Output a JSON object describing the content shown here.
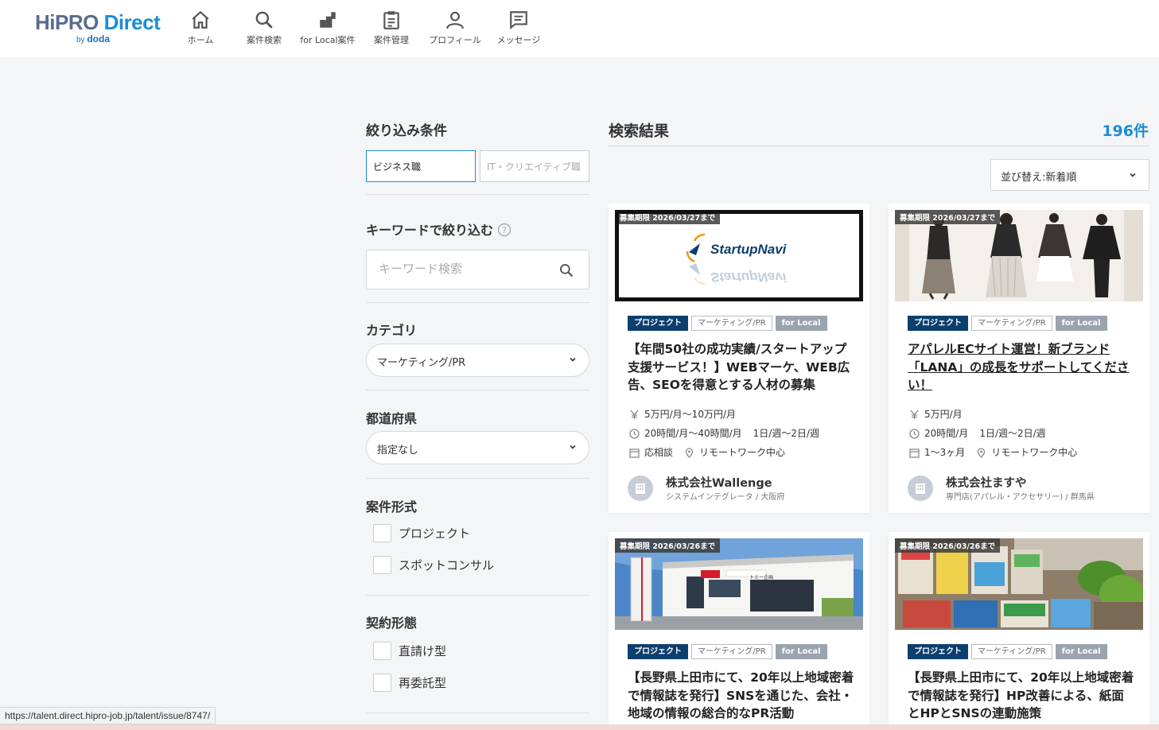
{
  "header": {
    "logo": {
      "part1": "HiPRO",
      "part2": " Direct",
      "by": "by",
      "brand": "doda"
    },
    "nav": [
      {
        "label": "ホーム",
        "icon": "home-icon"
      },
      {
        "label": "案件検索",
        "icon": "search-icon"
      },
      {
        "label": "for Local案件",
        "icon": "local-icon"
      },
      {
        "label": "案件管理",
        "icon": "clipboard-icon"
      },
      {
        "label": "プロフィール",
        "icon": "profile-icon"
      },
      {
        "label": "メッセージ",
        "icon": "message-icon"
      }
    ]
  },
  "filter": {
    "title": "絞り込み条件",
    "tabs": [
      {
        "label": "ビジネス職",
        "active": true
      },
      {
        "label": "IT・クリエイティブ職",
        "active": false
      }
    ],
    "keyword": {
      "title": "キーワードで絞り込む",
      "placeholder": "キーワード検索"
    },
    "category": {
      "title": "カテゴリ",
      "value": "マーケティング/PR"
    },
    "prefecture": {
      "title": "都道府県",
      "value": "指定なし"
    },
    "format": {
      "title": "案件形式",
      "options": [
        "プロジェクト",
        "スポットコンサル"
      ]
    },
    "contract": {
      "title": "契約形態",
      "options": [
        "直請け型",
        "再委託型"
      ]
    }
  },
  "results": {
    "title": "検索結果",
    "count": "196件",
    "sort": "並び替え:新着順",
    "cards": [
      {
        "deadline": "募集期限 2026/03/27まで",
        "image_text": "StartupNavi",
        "tags": [
          "プロジェクト",
          "マーケティング/PR",
          "for Local"
        ],
        "title": "【年間50社の成功実績/スタートアップ支援サービス！】WEBマーケ、WEB広告、SEOを得意とする人材の募集",
        "pay": "5万円/月～10万円/月",
        "hours": "20時間/月～40時間/月",
        "days": "1日/週～2日/週",
        "period": "応相談",
        "location": "リモートワーク中心",
        "company": "株式会社Wallenge",
        "company_sub": "システムインテグレータ / 大阪府"
      },
      {
        "deadline": "募集期限 2026/03/27まで",
        "tags": [
          "プロジェクト",
          "マーケティング/PR",
          "for Local"
        ],
        "title": "アパレルECサイト運営！新ブランド「LANA」の成長をサポートしてください！",
        "pay": "5万円/月",
        "hours": "20時間/月",
        "days": "1日/週～2日/週",
        "period": "1～3ヶ月",
        "location": "リモートワーク中心",
        "company": "株式会社ますや",
        "company_sub": "専門店(アパレル・アクセサリー) / 群馬県"
      },
      {
        "deadline": "募集期限 2026/03/26まで",
        "image_text": "トミー企画",
        "tags": [
          "プロジェクト",
          "マーケティング/PR",
          "for Local"
        ],
        "title": "【長野県上田市にて、20年以上地域密着で情報誌を発行】SNSを通じた、会社・地域の情報の総合的なPR活動"
      },
      {
        "deadline": "募集期限 2026/03/26まで",
        "tags": [
          "プロジェクト",
          "マーケティング/PR",
          "for Local"
        ],
        "title": "【長野県上田市にて、20年以上地域密着で情報誌を発行】HP改善による、紙面とHPとSNSの連動施策"
      }
    ]
  },
  "status_url": "https://talent.direct.hipro-job.jp/talent/issue/8747/",
  "colors": {
    "accent": "#1a8ed1",
    "project_tag": "#0d3f6e",
    "local_tag": "#9aa3ae"
  }
}
